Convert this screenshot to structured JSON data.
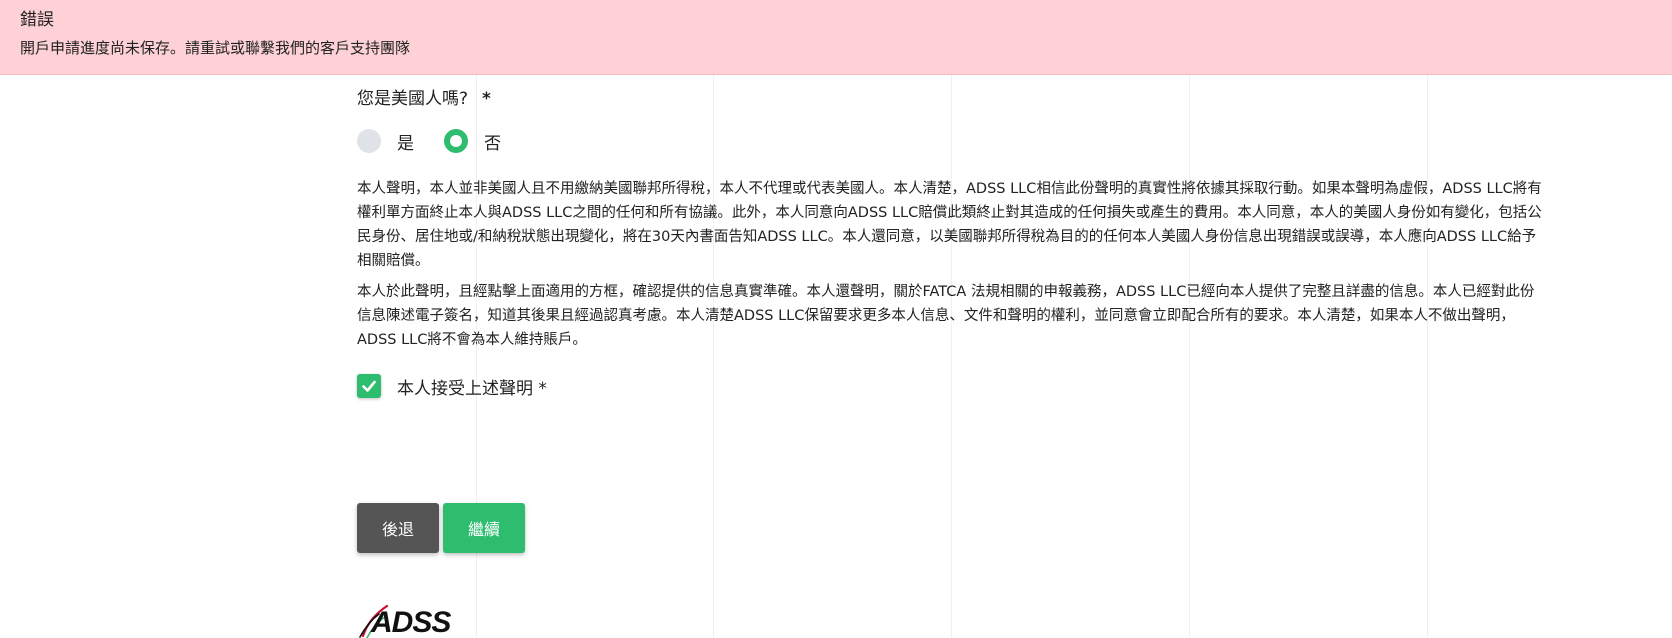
{
  "alert": {
    "title": "錯誤",
    "message": "開戶申請進度尚未保存。請重試或聯繫我們的客戶支持團隊",
    "background": "#fdd1d5"
  },
  "question": {
    "label": "您是美國人嗎?",
    "required_mark": "*",
    "options": [
      {
        "label": "是",
        "selected": false
      },
      {
        "label": "否",
        "selected": true
      }
    ]
  },
  "declaration": {
    "paragraph1": "本人聲明，本人並非美國人且不用繳納美國聯邦所得稅，本人不代理或代表美國人。本人清楚，ADSS LLC相信此份聲明的真實性將依據其採取行動。如果本聲明為虛假，ADSS LLC將有權利單方面終止本人與ADSS LLC之間的任何和所有協議。此外，本人同意向ADSS LLC賠償此類終止對其造成的任何損失或產生的費用。本人同意，本人的美國人身份如有變化，包括公民身份、居住地或/和納稅狀態出現變化，將在30天內書面告知ADSS LLC。本人還同意，以美國聯邦所得稅為目的的任何本人美國人身份信息出現錯誤或誤導，本人應向ADSS LLC給予相關賠償。",
    "paragraph2": "本人於此聲明，且經點擊上面適用的方框，確認提供的信息真實準確。本人還聲明，關於FATCA 法規相關的申報義務，ADSS LLC已經向本人提供了完整且詳盡的信息。本人已經對此份信息陳述電子簽名，知道其後果且經過認真考慮。本人清楚ADSS LLC保留要求更多本人信息、文件和聲明的權利，並同意會立即配合所有的要求。本人清楚，如果本人不做出聲明，ADSS LLC將不會為本人維持賬戶。"
  },
  "accept": {
    "label": "本人接受上述聲明",
    "required_mark": "*",
    "checked": true
  },
  "buttons": {
    "back_label": "後退",
    "next_label": "繼續"
  },
  "logo": {
    "text": "ADSS"
  },
  "colors": {
    "accent": "#2ebd6f",
    "back_button": "#555555"
  }
}
